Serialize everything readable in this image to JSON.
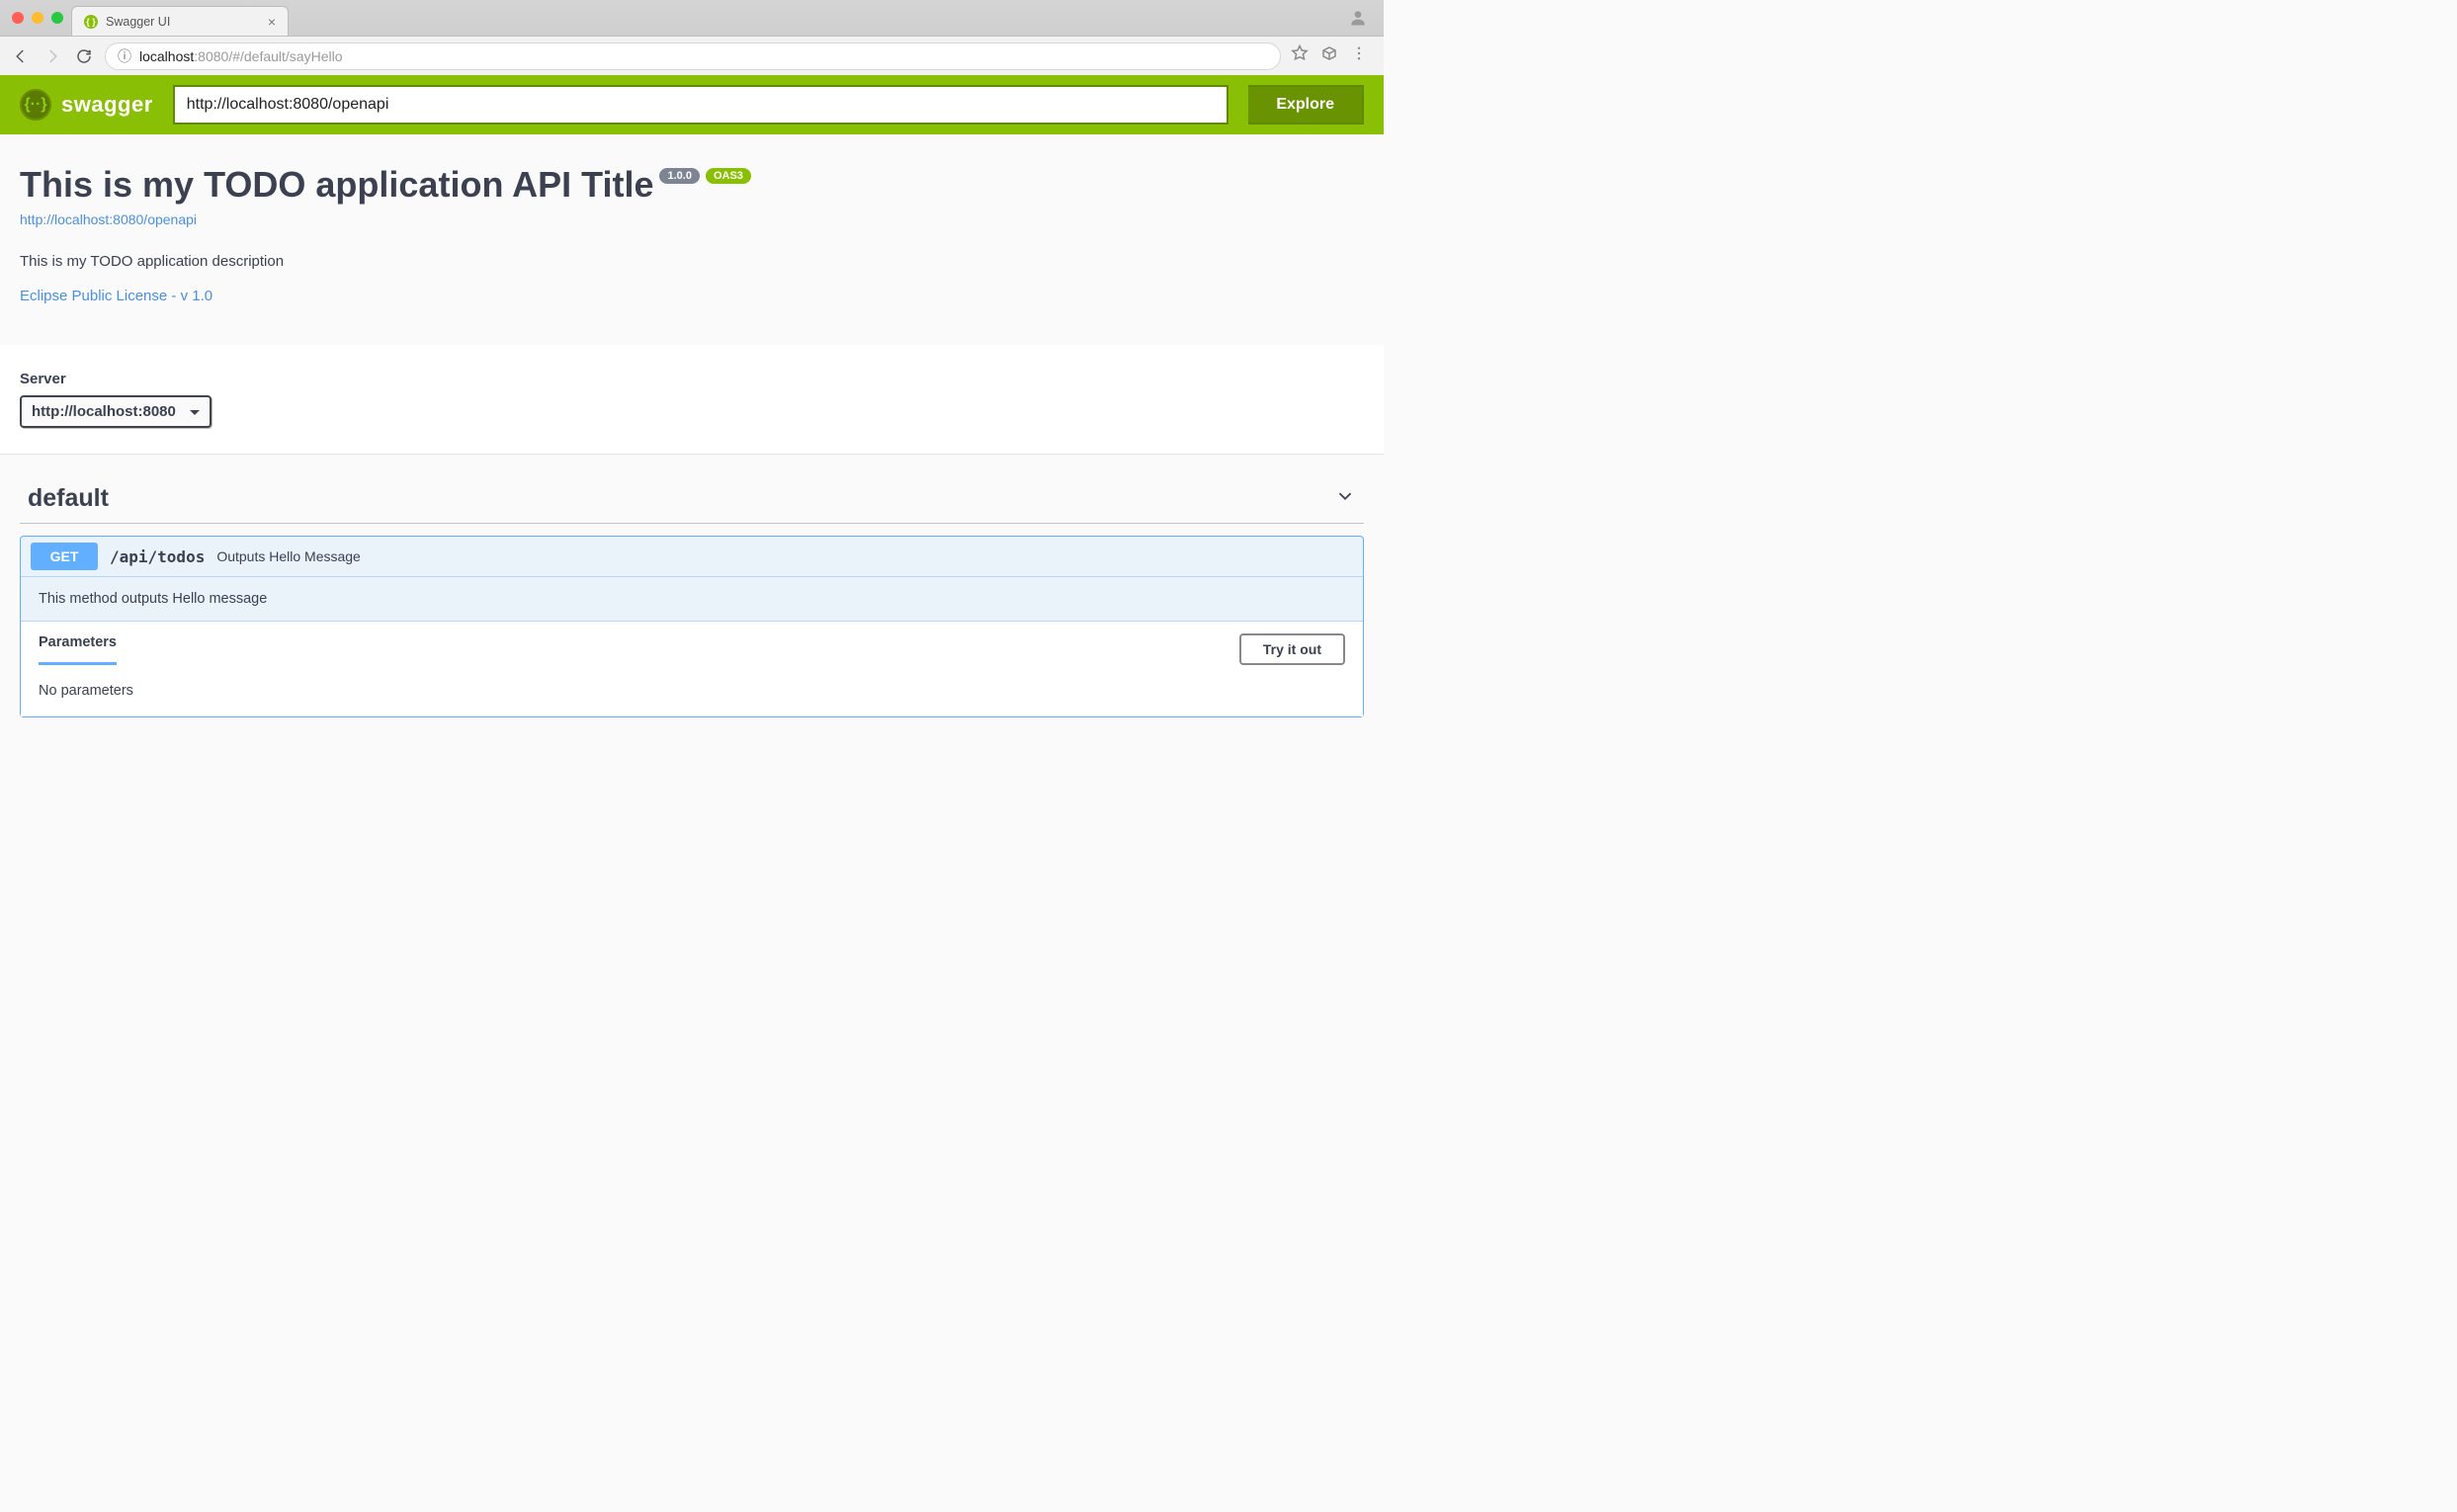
{
  "browser": {
    "tab_title": "Swagger UI",
    "url_host": "localhost",
    "url_port": ":8080",
    "url_path": "/#/default/sayHello"
  },
  "header": {
    "logo_text": "swagger",
    "spec_url": "http://localhost:8080/openapi",
    "explore_label": "Explore"
  },
  "info": {
    "title": "This is my TODO application API Title",
    "version": "1.0.0",
    "oas_badge": "OAS3",
    "spec_link": "http://localhost:8080/openapi",
    "description": "This is my TODO application description",
    "license_label": "Eclipse Public License - v 1.0"
  },
  "server": {
    "label": "Server",
    "selected": "http://localhost:8080"
  },
  "tag": {
    "name": "default"
  },
  "operation": {
    "method": "GET",
    "path": "/api/todos",
    "summary": "Outputs Hello Message",
    "description": "This method outputs Hello message",
    "parameters_label": "Parameters",
    "tryout_label": "Try it out",
    "no_params": "No parameters"
  }
}
